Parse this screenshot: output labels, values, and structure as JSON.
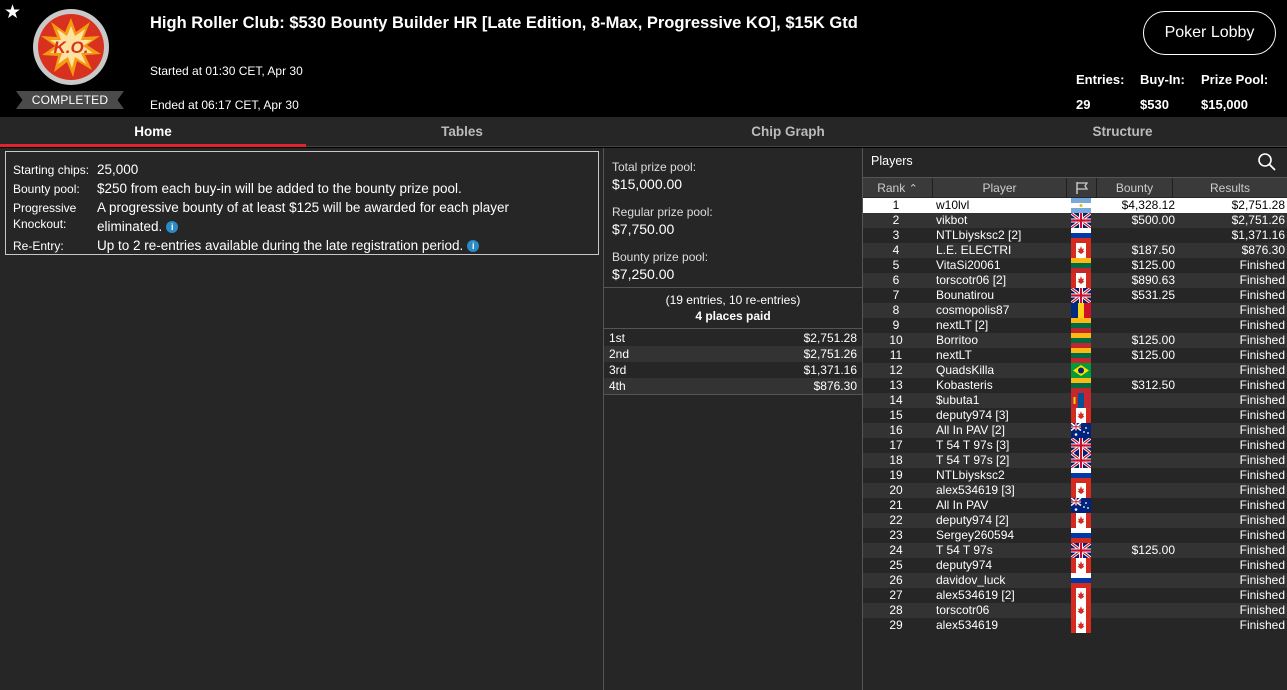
{
  "header": {
    "title": "High Roller Club: $530 Bounty Builder HR [Late Edition, 8-Max, Progressive KO], $15K Gtd",
    "started": "Started at 01:30 CET, Apr 30",
    "ended": "Ended at 06:17 CET, Apr 30",
    "status_badge": "COMPLETED",
    "logo_text": "K.O.",
    "lobby_button": "Poker Lobby",
    "stats": [
      {
        "label": "Entries:",
        "value": "29"
      },
      {
        "label": "Buy-In:",
        "value": "$530"
      },
      {
        "label": "Prize Pool:",
        "value": "$15,000"
      }
    ]
  },
  "tabs": [
    "Home",
    "Tables",
    "Chip Graph",
    "Structure"
  ],
  "info": {
    "starting_chips_label": "Starting chips:",
    "starting_chips": "25,000",
    "bounty_pool_label": "Bounty pool:",
    "bounty_pool": "$250 from each buy-in will be added to the bounty prize pool.",
    "pko_label_1": "Progressive",
    "pko_label_2": "Knockout:",
    "pko_1": "A progressive bounty of at least $125 will be awarded for each player",
    "pko_2": "eliminated.",
    "reentry_label": "Re-Entry:",
    "reentry": "Up to 2 re-entries available during the late registration period.",
    "info_icon": "i"
  },
  "prize": {
    "total_label": "Total prize pool:",
    "total": "$15,000.00",
    "regular_label": "Regular prize pool:",
    "regular": "$7,750.00",
    "bounty_label": "Bounty prize pool:",
    "bounty": "$7,250.00",
    "entries_note": "(19 entries, 10 re-entries)",
    "places_note": "4 places paid",
    "payouts": [
      {
        "place": "1st",
        "amount": "$2,751.28"
      },
      {
        "place": "2nd",
        "amount": "$2,751.26"
      },
      {
        "place": "3rd",
        "amount": "$1,371.16"
      },
      {
        "place": "4th",
        "amount": "$876.30"
      }
    ]
  },
  "players": {
    "title": "Players",
    "columns": {
      "rank": "Rank",
      "player": "Player",
      "bounty": "Bounty",
      "results": "Results"
    },
    "rows": [
      {
        "rank": "1",
        "name": "w10lvl",
        "flag": "argentina",
        "bounty": "$4,328.12",
        "result": "$2,751.28"
      },
      {
        "rank": "2",
        "name": "vikbot",
        "flag": "uk",
        "bounty": "$500.00",
        "result": "$2,751.26"
      },
      {
        "rank": "3",
        "name": "NTLbiysksc2 [2]",
        "flag": "russia",
        "bounty": "",
        "result": "$1,371.16"
      },
      {
        "rank": "4",
        "name": "L.E. ELECTRI",
        "flag": "canada",
        "bounty": "$187.50",
        "result": "$876.30"
      },
      {
        "rank": "5",
        "name": "VitaSi20061",
        "flag": "lithuania",
        "bounty": "$125.00",
        "result": "Finished"
      },
      {
        "rank": "6",
        "name": "torscotr06 [2]",
        "flag": "canada",
        "bounty": "$890.63",
        "result": "Finished"
      },
      {
        "rank": "7",
        "name": "Bounatirou",
        "flag": "uk",
        "bounty": "$531.25",
        "result": "Finished"
      },
      {
        "rank": "8",
        "name": "cosmopolis87",
        "flag": "romania",
        "bounty": "",
        "result": "Finished"
      },
      {
        "rank": "9",
        "name": "nextLT [2]",
        "flag": "lithuania",
        "bounty": "",
        "result": "Finished"
      },
      {
        "rank": "10",
        "name": "Borritoo",
        "flag": "lithuania",
        "bounty": "$125.00",
        "result": "Finished"
      },
      {
        "rank": "11",
        "name": "nextLT",
        "flag": "lithuania",
        "bounty": "$125.00",
        "result": "Finished"
      },
      {
        "rank": "12",
        "name": "QuadsKilla",
        "flag": "brazil",
        "bounty": "",
        "result": "Finished"
      },
      {
        "rank": "13",
        "name": "Kobasteris",
        "flag": "lithuania",
        "bounty": "$312.50",
        "result": "Finished"
      },
      {
        "rank": "14",
        "name": "$ubuta1",
        "flag": "mongolia",
        "bounty": "",
        "result": "Finished"
      },
      {
        "rank": "15",
        "name": "deputy974 [3]",
        "flag": "canada",
        "bounty": "",
        "result": "Finished"
      },
      {
        "rank": "16",
        "name": "All In PAV [2]",
        "flag": "australia",
        "bounty": "",
        "result": "Finished"
      },
      {
        "rank": "17",
        "name": "T 54 T 97s [3]",
        "flag": "uk",
        "bounty": "",
        "result": "Finished"
      },
      {
        "rank": "18",
        "name": "T 54 T 97s [2]",
        "flag": "uk",
        "bounty": "",
        "result": "Finished"
      },
      {
        "rank": "19",
        "name": "NTLbiysksc2",
        "flag": "russia",
        "bounty": "",
        "result": "Finished"
      },
      {
        "rank": "20",
        "name": "alex534619 [3]",
        "flag": "canada",
        "bounty": "",
        "result": "Finished"
      },
      {
        "rank": "21",
        "name": "All In PAV",
        "flag": "australia",
        "bounty": "",
        "result": "Finished"
      },
      {
        "rank": "22",
        "name": "deputy974 [2]",
        "flag": "canada",
        "bounty": "",
        "result": "Finished"
      },
      {
        "rank": "23",
        "name": "Sergey260594",
        "flag": "russia",
        "bounty": "",
        "result": "Finished"
      },
      {
        "rank": "24",
        "name": "T 54 T 97s",
        "flag": "uk",
        "bounty": "$125.00",
        "result": "Finished"
      },
      {
        "rank": "25",
        "name": "deputy974",
        "flag": "canada",
        "bounty": "",
        "result": "Finished"
      },
      {
        "rank": "26",
        "name": "davidov_luck",
        "flag": "russia",
        "bounty": "",
        "result": "Finished"
      },
      {
        "rank": "27",
        "name": "alex534619 [2]",
        "flag": "canada",
        "bounty": "",
        "result": "Finished"
      },
      {
        "rank": "28",
        "name": "torscotr06",
        "flag": "canada",
        "bounty": "",
        "result": "Finished"
      },
      {
        "rank": "29",
        "name": "alex534619",
        "flag": "canada",
        "bounty": "",
        "result": "Finished"
      }
    ]
  },
  "colors": {
    "accent": "#e0232d",
    "info_icon": "#2b8bc6",
    "panel_bg": "#262626"
  }
}
